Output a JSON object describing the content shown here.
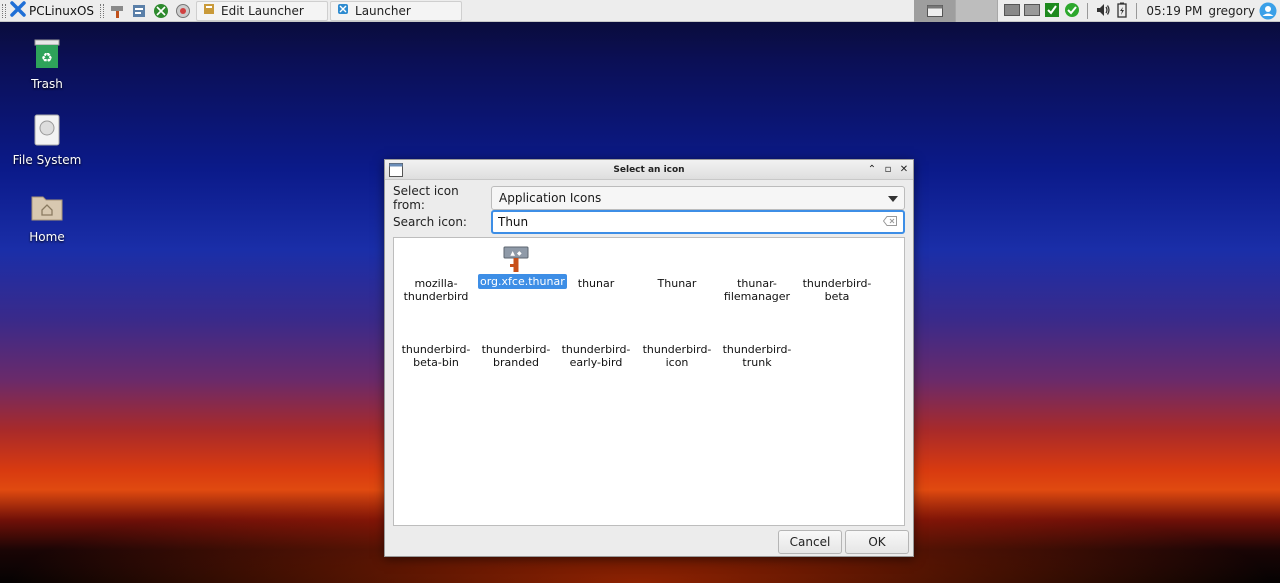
{
  "panel": {
    "menu_label": "PCLinuxOS",
    "tasks": [
      {
        "label": "Edit Launcher"
      },
      {
        "label": "Launcher"
      }
    ],
    "clock": "05:19 PM",
    "user": "gregory"
  },
  "desktop": {
    "icons": [
      {
        "label": "Trash"
      },
      {
        "label": "File System"
      },
      {
        "label": "Home"
      }
    ]
  },
  "dialog": {
    "title": "Select an icon",
    "select_from_label": "Select icon from:",
    "select_from_value": "Application Icons",
    "search_label": "Search icon:",
    "search_value": "Thun",
    "icons": [
      {
        "label": "mozilla-thunderbird",
        "selected": false
      },
      {
        "label": "org.xfce.thunar",
        "selected": true
      },
      {
        "label": "thunar",
        "selected": false
      },
      {
        "label": "Thunar",
        "selected": false
      },
      {
        "label": "thunar-filemanager",
        "selected": false
      },
      {
        "label": "thunderbird-beta",
        "selected": false
      },
      {
        "label": "thunderbird-beta-bin",
        "selected": false
      },
      {
        "label": "thunderbird-branded",
        "selected": false
      },
      {
        "label": "thunderbird-early-bird",
        "selected": false
      },
      {
        "label": "thunderbird-icon",
        "selected": false
      },
      {
        "label": "thunderbird-trunk",
        "selected": false
      }
    ],
    "cancel_label": "Cancel",
    "ok_label": "OK"
  },
  "colors": {
    "selection": "#3d8ee6",
    "panel_bg": "#ededed"
  }
}
